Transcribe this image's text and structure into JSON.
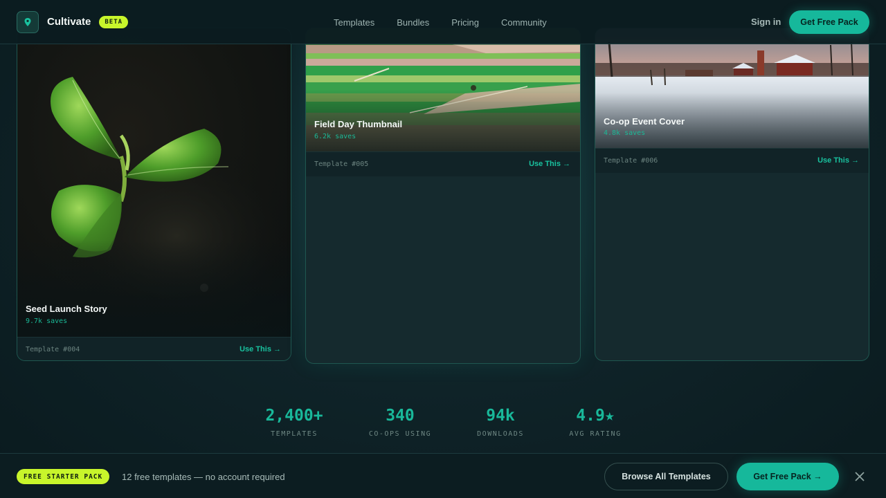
{
  "header": {
    "brand": "Cultivate",
    "badge": "BETA",
    "nav": [
      "Templates",
      "Bundles",
      "Pricing",
      "Community"
    ],
    "sign_in": "Sign in",
    "cta": "Get Free Pack"
  },
  "cards": [
    {
      "title": "Seed Launch Story",
      "saves": "9.7k saves",
      "template_id": "Template #004",
      "action": "Use This →",
      "image": "sprout-photo"
    },
    {
      "title": "Field Day Thumbnail",
      "saves": "6.2k saves",
      "template_id": "Template #005",
      "action": "Use This →",
      "image": "farm-fields-photo"
    },
    {
      "title": "Co-op Event Cover",
      "saves": "4.8k saves",
      "template_id": "Template #006",
      "action": "Use This →",
      "image": "snowy-farm-photo"
    }
  ],
  "stats": [
    {
      "value": "2,400+",
      "label": "TEMPLATES"
    },
    {
      "value": "340",
      "label": "CO-OPS USING"
    },
    {
      "value": "94k",
      "label": "DOWNLOADS"
    },
    {
      "value": "4.9★",
      "label": "AVG RATING"
    }
  ],
  "bottom_bar": {
    "badge": "FREE STARTER PACK",
    "text": "12 free templates — no account required",
    "browse": "Browse All Templates",
    "cta": "Get Free Pack →"
  },
  "colors": {
    "accent": "#16b89b",
    "lime": "#c8f52b",
    "background": "#0f2328"
  },
  "icons": [
    "location-pin-icon",
    "close-icon"
  ]
}
